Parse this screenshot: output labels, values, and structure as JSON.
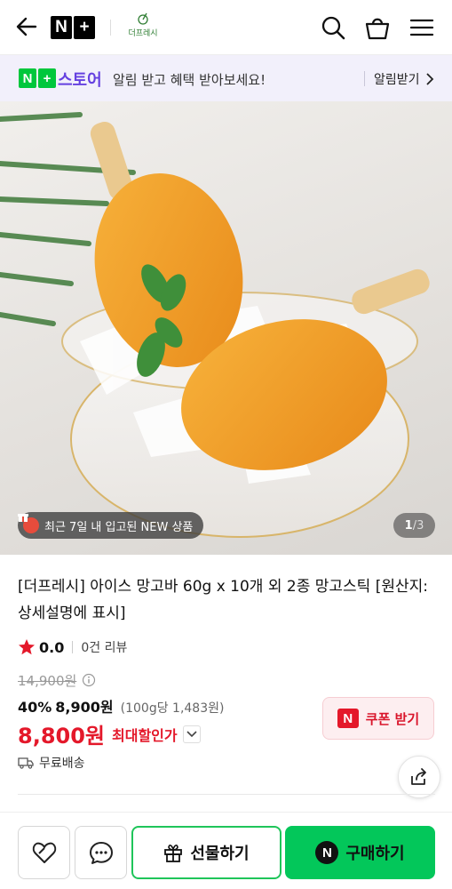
{
  "header": {
    "logo_n": "N",
    "logo_plus": "+",
    "brand_name": "더프레시"
  },
  "banner": {
    "logo_n": "N",
    "logo_plus": "+",
    "store_label": "스토어",
    "message": "알림 받고 혜택 받아보세요!",
    "cta_label": "알림받기"
  },
  "gallery": {
    "badge_text": "최근 7일 내 입고된 NEW 상품",
    "current": "1",
    "total": "/3"
  },
  "product": {
    "title": "[더프레시] 아이스 망고바 60g x 10개 외 2종 망고스틱 [원산지:상세설명에 표시]",
    "rating": "0.0",
    "review_count": "0건 리뷰",
    "original_price": "14,900원",
    "discount_percent": "40%",
    "sale_price": "8,900원",
    "unit_price": "(100g당 1,483원)",
    "max_discount_price": "8,800원",
    "max_discount_label": "최대할인가",
    "shipping": "무료배송"
  },
  "coupon": {
    "icon_letter": "N",
    "label": "쿠폰 받기"
  },
  "bottom_bar": {
    "gift_label": "선물하기",
    "buy_icon_letter": "N",
    "buy_label": "구매하기"
  },
  "colors": {
    "naver_green": "#03c75a",
    "store_purple": "#6540e0",
    "sale_red": "#e4182a",
    "banner_bg": "#f2f0fb"
  }
}
